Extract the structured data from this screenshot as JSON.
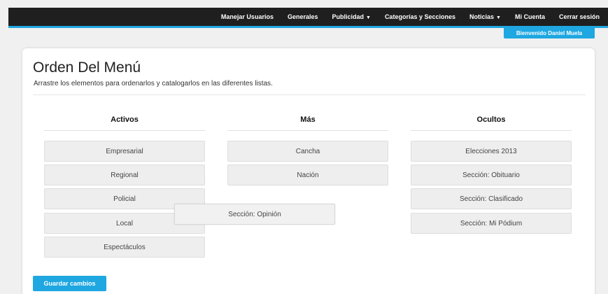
{
  "nav": {
    "items": [
      {
        "label": "Manejar Usuarios",
        "caret": ""
      },
      {
        "label": "Generales",
        "caret": ""
      },
      {
        "label": "Publicidad",
        "caret": "▼"
      },
      {
        "label": "Categorías y Secciones",
        "caret": ""
      },
      {
        "label": "Noticias",
        "caret": "▼"
      },
      {
        "label": "Mi Cuenta",
        "caret": ""
      },
      {
        "label": "Cerrar sesión",
        "caret": ""
      }
    ],
    "welcome": "Bienvenido Daniel Muela"
  },
  "page": {
    "title": "Orden Del Menú",
    "subtitle": "Arrastre los elementos para ordenarlos y catalogarlos en las diferentes listas."
  },
  "columns": [
    {
      "header": "Activos",
      "items": [
        "Empresarial",
        "Regional",
        "Policial",
        "Local",
        "Espectáculos"
      ]
    },
    {
      "header": "Más",
      "items": [
        "Cancha",
        "Nación"
      ]
    },
    {
      "header": "Ocultos",
      "items": [
        "Elecciones 2013",
        "Sección: Obituario",
        "Sección: Clasificado",
        "Sección: Mi Pódium"
      ]
    }
  ],
  "dragging_item": "Sección: Opinión",
  "actions": {
    "save_label": "Guardar cambios"
  },
  "colors": {
    "accent": "#1ea7e1",
    "topbar": "#1f1f1f"
  }
}
